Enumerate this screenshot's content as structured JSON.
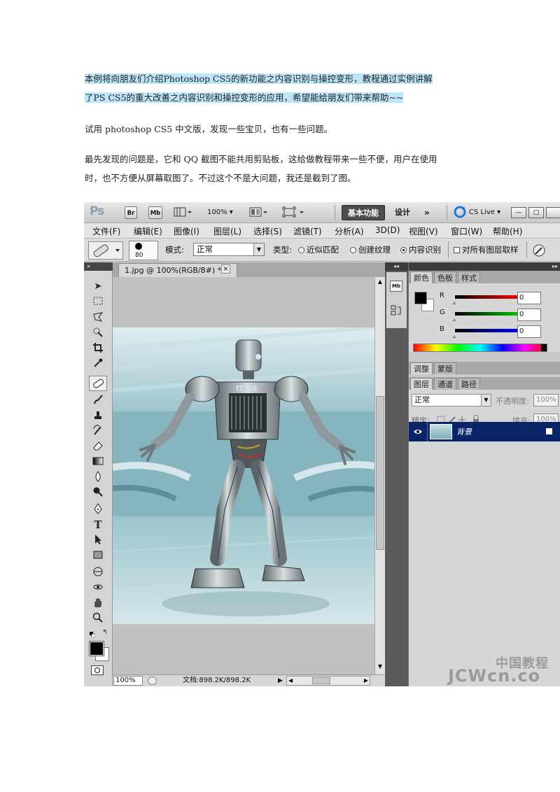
{
  "intro": {
    "line1": "本例将向朋友们介绍Photoshop CS5的新功能之内容识别与操控变形，教程通过实例讲解",
    "line2": "了PS CS5的重大改善之内容识别和操控变形的应用，希望能给朋友们带来帮助~~"
  },
  "para2": "试用 photoshop CS5 中文版，发现一些宝贝，也有一些问题。",
  "para3": {
    "line1": "最先发现的问题是，它和 QQ 截图不能共用剪贴板，这给做教程带来一些不便，用户在使用",
    "line2": "时，也不方便从屏幕取图了。不过这个不是大问题，我还是截到了图。"
  },
  "ps": {
    "appbar": {
      "logo": "Ps",
      "br": "Br",
      "mb": "Mb",
      "zoom": "100% ▾",
      "workspace_essential": "基本功能",
      "workspace_design": "设计",
      "more": "»",
      "cs_live": "CS Live ▾",
      "win_min": "—",
      "win_restore": "▢"
    },
    "menu": [
      "文件(F)",
      "编辑(E)",
      "图像(I)",
      "图层(L)",
      "选择(S)",
      "滤镜(T)",
      "分析(A)",
      "3D(D)",
      "视图(V)",
      "窗口(W)",
      "帮助(H)"
    ],
    "options": {
      "brush_size": "80",
      "mode_label": "模式:",
      "mode_value": "正常",
      "type_label": "类型:",
      "radio_proximity": "近似匹配",
      "radio_texture": "创建纹理",
      "radio_content": "内容识别",
      "sample_all": "对所有图层取样"
    },
    "document": {
      "tab_title": "1.jpg @ 100%(RGB/8#) *",
      "close": "×",
      "zoom": "100%",
      "doc_size": "文档:898.2K/898.2K",
      "watermark_text": "IT 24"
    },
    "panels": {
      "color_tabs": [
        "颜色",
        "色板",
        "样式"
      ],
      "r_label": "R",
      "g_label": "G",
      "b_label": "B",
      "r_value": "0",
      "g_value": "0",
      "b_value": "0",
      "adjust_tabs": [
        "调整",
        "蒙版"
      ],
      "layer_tabs": [
        "图层",
        "通道",
        "路径"
      ],
      "blend_mode": "正常",
      "opacity_label": "不透明度:",
      "opacity_value": "100%",
      "lock_label": "锁定:",
      "fill_label": "填充:",
      "fill_value": "100%",
      "layer_name": "背景"
    }
  },
  "watermark": "JCWcn.co",
  "watermark_cn": "中国教程",
  "colors": {
    "highlight": "#bde6fb",
    "layer_selected": "#0a246a",
    "workspace_btn": "#4d4d4d"
  }
}
